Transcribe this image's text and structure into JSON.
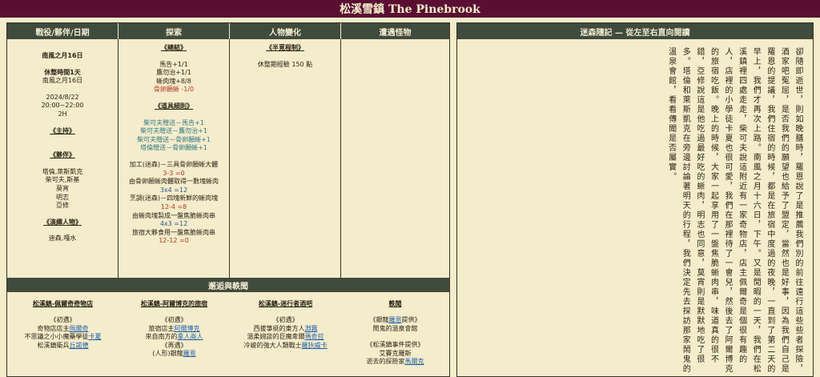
{
  "title": "松溪雪鎮 The Pinebrook",
  "columns": {
    "col1": "戰役/夥伴/日期",
    "col2": "探索",
    "col3": "人物變化",
    "col4": "遭遇怪物"
  },
  "date_col": {
    "l1": "南風之月16日",
    "l2": "休整時間1天",
    "l3": "南風之月16日",
    "l4": "2024/8/22",
    "l5": "20:00~22:00",
    "l6": "2H",
    "main_title": "《主持》",
    "partner_title": "《夥伴》",
    "partners": [
      "塔倫,萊斯凱克",
      "柴可夫,斯基",
      "莫宵",
      "明志",
      "亞修"
    ],
    "actor_title": "《演繹人物》",
    "actors": "迪森,嘎水"
  },
  "explore_col": {
    "summary_title": "《總結》",
    "s1": "馬告+1/1",
    "s2": "鷹勿治+1/1",
    "s3": "蜥肉塊+8/8",
    "s4": "骨卵願蜥 -1/0",
    "tools_title": "《道具細則》",
    "t1": "柴可夫贈送－馬告+1",
    "t2": "柴可夫贈送－鷹勿治+1",
    "t3": "柴可夫贈送－骨卵願蜥+1",
    "t4": "塔倫贈送－骨卵願蜥+1",
    "c1": "加工(迷森)－三具骨卵願蜥大體",
    "c1v": "3-3 =0",
    "c2": "由骨卵願蜥肉體取得一數塊蜥肉",
    "c2v": "3x4 =12",
    "c3": "烹調(迷森)－四塊新鮮的蜥肉塊",
    "c3v": "12-4 =8",
    "c4": "由蜥肉塊製成一盤焦脆蜥肉串",
    "c4v": "4x3 =12",
    "c5": "旅宿大夥食用一盤焦脆蜥肉串",
    "c5v": "12-12 =0"
  },
  "change_col": {
    "title": "《半覓程制》",
    "line": "休整期經驗 150 點"
  },
  "encounter_col": {},
  "middle_title": "邂逅與軼聞",
  "bottom": {
    "b1": {
      "title": "松溪鎮-佩爾奇奇物店",
      "sub": "《初遇》",
      "l1a": "奇物店店主",
      "l1b": "佩爾奇",
      "l2a": "不思議之小小魔藥學徒",
      "l2b": "卡夏",
      "l3a": "松溪鎮衛兵",
      "l3b": "丘諾德"
    },
    "b2": {
      "title": "松溪鎮-阿爾博克的旅宿",
      "sub": "《初遇》",
      "l1a": "旅宿店主",
      "l1b": "阿爾博克",
      "l2a": "來自南方的",
      "l2b": "拿人商人",
      "sub2": "《再遇》",
      "l3a": "(人形)銀龍",
      "l3b": "羅恩"
    },
    "b3": {
      "title": "松溪鎮-迷行者酒吧",
      "sub": "《初遇》",
      "l1a": "西拔箏挺的東方人",
      "l1b": "淵霧",
      "l2a": "溫柔婉談的巨魔卑爾",
      "l2b": "瑪奇拉",
      "l3a": "冷峻的強大人類戰士",
      "l3b": "羅狄威卡"
    },
    "b4": {
      "title": "軼聞",
      "s1": "《銀龍",
      "s1l": "羅恩",
      "s1b": "提供》",
      "s1t": "鬧鬼的溫泉會館",
      "s2": "《松溪鎮事件提供》",
      "s2t": "艾賽克羅斯",
      "s3a": "逝去的探險家",
      "s3b": "馬爾克"
    }
  },
  "diary": {
    "title": "迷森隨記 — 從左至右直向閱讀",
    "text": "卻隨即逝世，則如晚膳時，羅恩說了是推薦我們別的前往遠行這些些者探險，酒家吧冤屈，是否我們的願望也給予了盟定，當然也是好事，因為我們自己是羅恩的提議，我們住宿的時候，都是在旅宿中度過的夜晚，一直到了第二天的早上，我們才再次上路。南風之月十六日，下午。又是閒暇的一天，我們在松溪鎮裡四處走走，柴可夫說這附近有一家奇物店，店主佩爾奇是個很有趣的人，店裡的小學徒卡夏也很可愛，我們在那裡待了一會兒，然後去了阿爾博克的旅宿吃飯。晚上的時候，大家一起享用了一盤焦脆蜥肉串，味道真的很不錯，亞修說這是他吃過最好吃的蜥肉，明志也同意，莫宵則是默默地吃了很多。塔倫和萊斯凱克在旁邊討論著明天的行程，我們決定先去探訪那家鬧鬼的溫泉會館，看看傳聞是否屬實。"
  }
}
